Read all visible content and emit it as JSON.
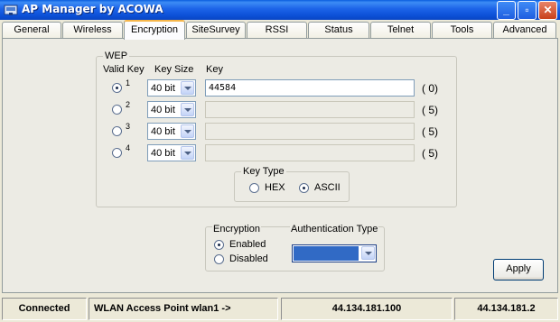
{
  "window": {
    "title": "AP Manager by ACOWA",
    "controls": {
      "minimize_icon": "minimize-icon",
      "maximize_icon": "maximize-icon",
      "close_icon": "close-icon"
    }
  },
  "tabs": [
    {
      "label": "General"
    },
    {
      "label": "Wireless"
    },
    {
      "label": "Encryption",
      "active": true
    },
    {
      "label": "SiteSurvey"
    },
    {
      "label": "RSSI"
    },
    {
      "label": "Status"
    },
    {
      "label": "Telnet"
    },
    {
      "label": "Tools"
    },
    {
      "label": "Advanced"
    }
  ],
  "wep": {
    "group_label": "WEP",
    "col_valid_key": "Valid Key",
    "col_key_size": "Key Size",
    "col_key": "Key",
    "rows": [
      {
        "num": "1",
        "selected": true,
        "size": "40 bit",
        "key": "44584",
        "count": "( 0)"
      },
      {
        "num": "2",
        "selected": false,
        "size": "40 bit",
        "key": "",
        "count": "( 5)"
      },
      {
        "num": "3",
        "selected": false,
        "size": "40 bit",
        "key": "",
        "count": "( 5)"
      },
      {
        "num": "4",
        "selected": false,
        "size": "40 bit",
        "key": "",
        "count": "( 5)"
      }
    ],
    "key_type": {
      "group_label": "Key Type",
      "options": [
        {
          "label": "HEX",
          "selected": false
        },
        {
          "label": "ASCII",
          "selected": true
        }
      ]
    }
  },
  "encryption": {
    "group_label": "Encryption",
    "options": [
      {
        "label": "Enabled",
        "selected": true
      },
      {
        "label": "Disabled",
        "selected": false
      }
    ],
    "auth_label": "Authentication Type",
    "auth_value": ""
  },
  "apply_label": "Apply",
  "statusbar": {
    "connection": "Connected",
    "device": "WLAN Access Point wlan1 ->",
    "local_ip": "44.134.181.100",
    "remote_ip": "44.134.181.2"
  },
  "colors": {
    "titlebar": "#0b4fd6",
    "tab_highlight": "#f6b64a",
    "selection": "#316ac5"
  }
}
